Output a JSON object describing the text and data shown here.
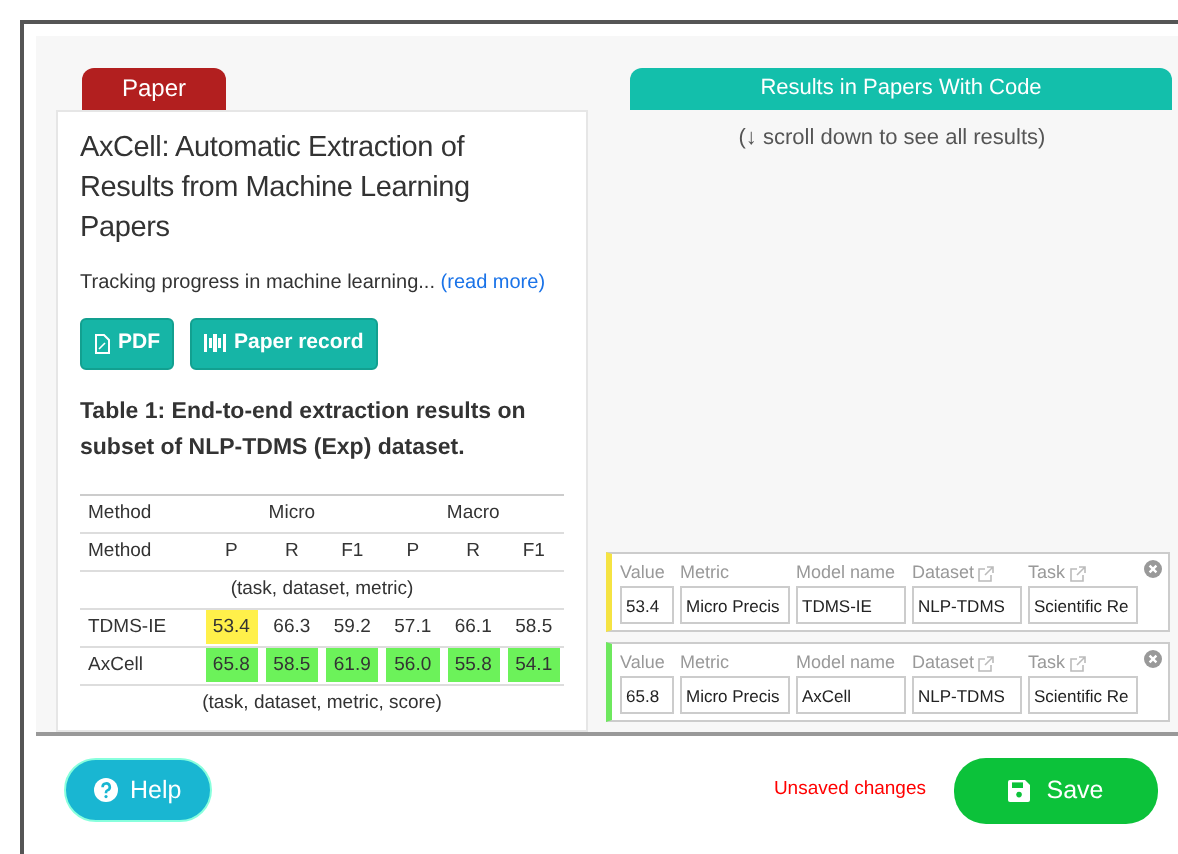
{
  "paper": {
    "tab": "Paper",
    "title": "AxCell: Automatic Extraction of Results from Machine Learning Papers",
    "abstract": "Tracking progress in machine learning...",
    "read_more": "(read more)",
    "buttons": [
      {
        "label": "PDF",
        "kind": "pdf"
      },
      {
        "label": "Paper record",
        "kind": "record"
      }
    ],
    "table": {
      "caption": "Table 1: End-to-end extraction results on subset of NLP-TDMS (Exp) dataset.",
      "method_labels": [
        "Method",
        "Method"
      ],
      "groups": [
        {
          "label": "Micro",
          "columns": [
            "P",
            "R",
            "F1"
          ]
        },
        {
          "label": "Macro",
          "columns": [
            "P",
            "R",
            "F1"
          ]
        }
      ],
      "rows": [
        {
          "kind": "section",
          "text": "(task, dataset, metric)"
        },
        {
          "kind": "data",
          "method": "TDMS-IE",
          "cells": [
            {
              "text": "53.4",
              "color": "#fff04a"
            },
            {
              "text": "66.3"
            },
            {
              "text": "59.2"
            },
            {
              "text": "57.1"
            },
            {
              "text": "66.1"
            },
            {
              "text": "58.5"
            }
          ]
        },
        {
          "kind": "data",
          "method": "AxCell",
          "cells": [
            {
              "text": "65.8",
              "color": "#6cf25a"
            },
            {
              "text": "58.5",
              "color": "#6cf25a"
            },
            {
              "text": "61.9",
              "color": "#6cf25a"
            },
            {
              "text": "56.0",
              "color": "#6cf25a"
            },
            {
              "text": "55.8",
              "color": "#6cf25a"
            },
            {
              "text": "54.1",
              "color": "#6cf25a"
            }
          ]
        },
        {
          "kind": "section",
          "text": "(task, dataset, metric, score)"
        }
      ]
    }
  },
  "results": {
    "tab": "Results in Papers With Code",
    "hint": "(↓ scroll down to see all results)",
    "items": [
      {
        "color": "#f5e342",
        "fields": [
          {
            "label": "Value",
            "value": "53.4",
            "link": false
          },
          {
            "label": "Metric",
            "value": "Micro Precis",
            "link": false
          },
          {
            "label": "Model name",
            "value": "TDMS-IE",
            "link": false
          },
          {
            "label": "Dataset",
            "value": "NLP-TDMS",
            "link": true
          },
          {
            "label": "Task",
            "value": "Scientific Re",
            "link": true
          }
        ]
      },
      {
        "color": "#6ee85e",
        "fields": [
          {
            "label": "Value",
            "value": "65.8",
            "link": false
          },
          {
            "label": "Metric",
            "value": "Micro Precis",
            "link": false
          },
          {
            "label": "Model name",
            "value": "AxCell",
            "link": false
          },
          {
            "label": "Dataset",
            "value": "NLP-TDMS",
            "link": true
          },
          {
            "label": "Task",
            "value": "Scientific Re",
            "link": true
          }
        ]
      }
    ]
  },
  "footer": {
    "help": "Help",
    "status": "Unsaved changes",
    "save": "Save"
  }
}
